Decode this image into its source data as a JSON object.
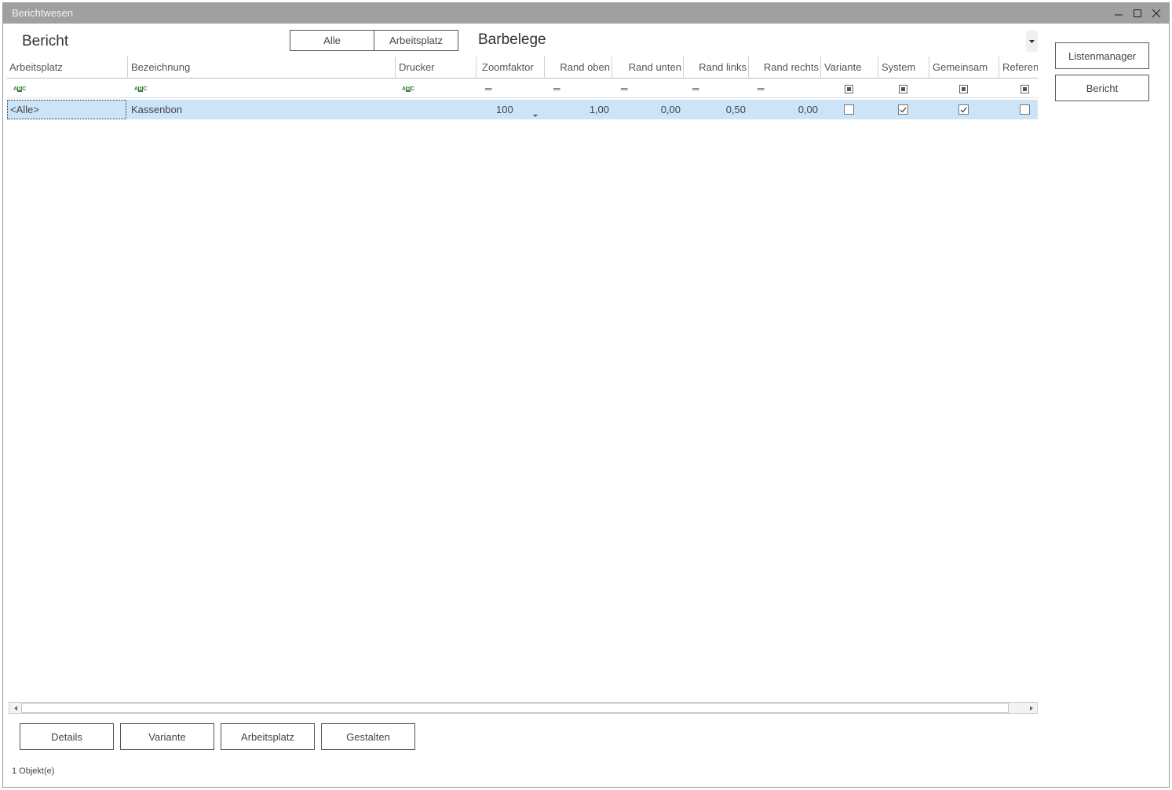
{
  "window": {
    "title": "Berichtwesen"
  },
  "header": {
    "title": "Bericht",
    "segments": [
      "Alle",
      "Arbeitsplatz"
    ],
    "report_value": "Barbelege"
  },
  "side_buttons": {
    "listenmanager": "Listenmanager",
    "bericht": "Bericht"
  },
  "grid": {
    "columns": [
      "Arbeitsplatz",
      "Bezeichnung",
      "Drucker",
      "Zoomfaktor",
      "Rand oben",
      "Rand unten",
      "Rand links",
      "Rand rechts",
      "Variante",
      "System",
      "Gemeinsam",
      "Referen"
    ],
    "filter_eq": "═",
    "rows": [
      {
        "arbeitsplatz": "<Alle>",
        "bezeichnung": "Kassenbon",
        "drucker": "",
        "zoomfaktor": "100",
        "rand_oben": "1,00",
        "rand_unten": "0,00",
        "rand_links": "0,50",
        "rand_rechts": "0,00",
        "variante": false,
        "system": true,
        "gemeinsam": true,
        "referenz": false
      }
    ]
  },
  "bottom_buttons": [
    "Details",
    "Variante",
    "Arbeitsplatz",
    "Gestalten"
  ],
  "status": "1 Objekt(e)",
  "icons": {
    "minimize": "minimize-icon",
    "maximize": "maximize-icon",
    "close": "close-icon",
    "dropdown": "chevron-down-icon",
    "filter_text": "abc-filter-icon",
    "filter_eq": "equals-filter-icon",
    "filter_check": "checkbox-filter-icon",
    "scroll_left": "arrow-left-icon",
    "scroll_right": "arrow-right-icon"
  },
  "colors": {
    "titlebar": "#a0a0a0",
    "selected_row": "#cce4f7",
    "filter_icon": "#2e7d32"
  }
}
